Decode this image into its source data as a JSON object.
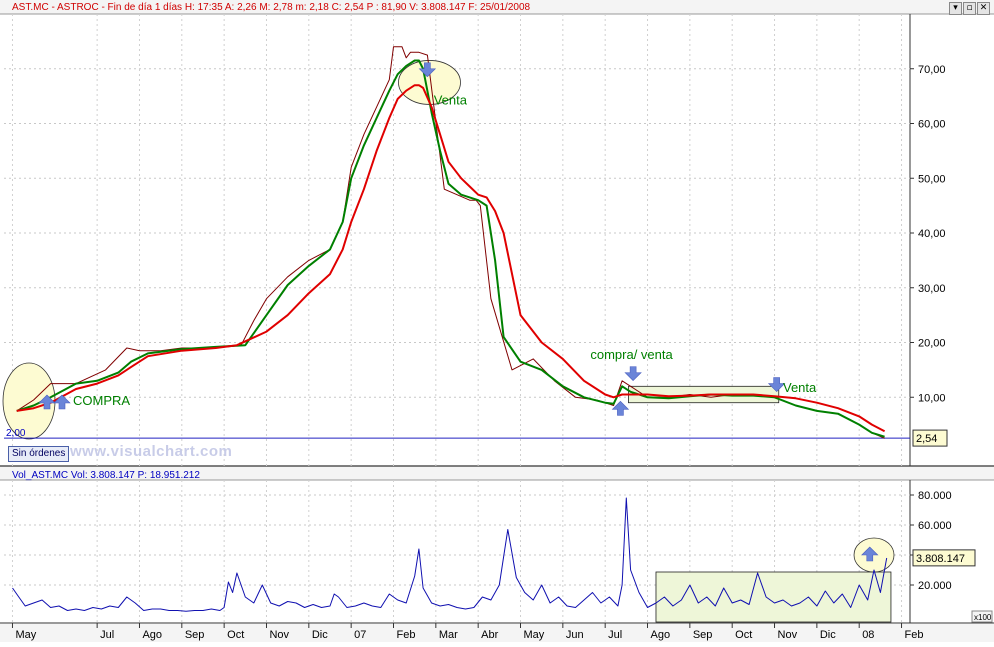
{
  "header": {
    "text": "AST.MC - ASTROC - Fin de día 1 días H: 17:35  A: 2,26  M: 2,78  m: 2,18  C: 2,54  P : 81,90  V: 3.808.147  F: 25/01/2008"
  },
  "window_buttons": [
    "▾",
    "▫",
    "✕"
  ],
  "window_buttons_names": [
    "minimize",
    "restore",
    "close"
  ],
  "sin_ordenes_label": "Sin órdenes",
  "watermark": "www.visualchart.com",
  "volume_header": "Vol_AST.MC  Vol: 3.808.147   P: 18.951.212",
  "volume_scale_note": "x100",
  "annotations": {
    "compra": "COMPRA",
    "venta_top": "Venta",
    "compra_venta": "compra/ venta",
    "venta_right": "Venta",
    "low_value": "2,00"
  },
  "colors": {
    "price": "#800000",
    "ma_fast": "#008000",
    "ma_slow": "#e00000",
    "volume": "#1010b0",
    "arrow": "#6a84d8",
    "highlight_fill": "#eef6d8",
    "axis_blue": "#2020c0"
  },
  "chart_data": [
    {
      "type": "line",
      "title": "AST.MC - ASTROC",
      "y_axis": "right",
      "ylim": [
        0,
        80
      ],
      "y_ticks": [
        "10,00",
        "20,00",
        "30,00",
        "40,00",
        "50,00",
        "60,00",
        "70,00"
      ],
      "y_tick_values": [
        10,
        20,
        30,
        40,
        50,
        60,
        70
      ],
      "last_value_label": "2,54",
      "last_value": 2.54,
      "x_months": [
        "May",
        "Jul",
        "Ago",
        "Sep",
        "Oct",
        "Nov",
        "Dic",
        "07",
        "Feb",
        "Mar",
        "Abr",
        "May",
        "Jun",
        "Jul",
        "Ago",
        "Sep",
        "Oct",
        "Nov",
        "Dic",
        "08",
        "Feb"
      ],
      "x_month_positions": [
        0,
        2,
        3,
        4,
        5,
        6,
        7,
        8,
        9,
        10,
        11,
        12,
        13,
        14,
        15,
        16,
        17,
        18,
        19,
        20,
        21
      ],
      "xlim": [
        -0.2,
        21.2
      ],
      "series": [
        {
          "role": "price",
          "x": [
            0.1,
            0.5,
            0.9,
            1.5,
            2.2,
            2.7,
            3.0,
            3.5,
            4.0,
            4.8,
            5.4,
            5.7,
            6.0,
            6.5,
            7.0,
            7.5,
            7.8,
            8.0,
            8.3,
            8.6,
            8.9,
            9.0,
            9.2,
            9.3,
            9.4,
            9.6,
            9.8,
            10.2,
            10.8,
            10.95,
            11.05,
            11.3,
            11.8,
            12.3,
            12.8,
            13.3,
            13.8,
            14.2,
            14.4,
            14.6,
            15.0,
            15.5,
            16.0,
            16.5,
            17.0,
            17.5,
            18.0,
            18.5,
            19.0,
            19.5,
            20.0,
            20.3,
            20.6
          ],
          "values": [
            7.5,
            9.5,
            12.5,
            12.5,
            15.0,
            19.0,
            18.5,
            18.5,
            19.0,
            19.0,
            19.5,
            24.0,
            28.0,
            32.0,
            35.0,
            37.0,
            42.0,
            52.0,
            58.0,
            63.0,
            68.0,
            74.0,
            74.0,
            72.0,
            73.0,
            73.0,
            72.5,
            48.0,
            46.0,
            46.0,
            45.0,
            28.0,
            15.0,
            17.0,
            13.0,
            10.0,
            9.5,
            8.5,
            13.0,
            12.0,
            10.0,
            10.0,
            10.5,
            10.0,
            10.5,
            10.5,
            10.0,
            8.5,
            7.5,
            7.0,
            5.0,
            3.5,
            2.5
          ]
        },
        {
          "role": "ma_fast",
          "x": [
            0.1,
            0.5,
            0.9,
            1.5,
            2.0,
            2.5,
            2.8,
            3.2,
            4.0,
            4.8,
            5.5,
            6.0,
            6.5,
            7.0,
            7.5,
            7.8,
            8.0,
            8.3,
            8.6,
            8.9,
            9.1,
            9.3,
            9.5,
            9.6,
            9.7,
            9.9,
            10.1,
            10.3,
            10.6,
            10.8,
            11.0,
            11.2,
            11.4,
            11.6,
            12.0,
            12.5,
            13.0,
            13.5,
            14.0,
            14.2,
            14.4,
            14.6,
            15.0,
            15.5,
            16.0,
            16.5,
            17.0,
            17.5,
            18.0,
            18.5,
            19.0,
            19.5,
            20.0,
            20.3,
            20.6
          ],
          "values": [
            7.5,
            8.5,
            10.0,
            12.5,
            13.0,
            14.5,
            16.5,
            18.0,
            18.8,
            19.2,
            19.5,
            25.0,
            30.5,
            34.0,
            37.0,
            42.0,
            50.0,
            56.0,
            61.0,
            66.0,
            69.0,
            70.5,
            71.5,
            71.5,
            70.0,
            62.0,
            55.0,
            49.0,
            47.0,
            46.5,
            46.0,
            45.0,
            35.0,
            21.0,
            16.5,
            15.0,
            12.0,
            10.0,
            9.0,
            8.8,
            12.0,
            11.0,
            10.0,
            9.8,
            10.2,
            10.5,
            10.3,
            10.3,
            10.0,
            8.5,
            7.5,
            7.0,
            5.0,
            3.5,
            2.8
          ]
        },
        {
          "role": "ma_slow",
          "x": [
            0.1,
            0.5,
            0.9,
            1.5,
            2.0,
            2.5,
            2.8,
            3.2,
            4.0,
            4.8,
            5.3,
            6.0,
            6.5,
            7.0,
            7.5,
            7.8,
            8.0,
            8.3,
            8.6,
            8.9,
            9.1,
            9.3,
            9.5,
            9.6,
            9.7,
            9.9,
            10.1,
            10.3,
            10.6,
            10.8,
            11.0,
            11.2,
            11.4,
            11.6,
            12.0,
            12.5,
            13.0,
            13.5,
            14.0,
            14.2,
            14.4,
            14.6,
            15.0,
            15.5,
            16.0,
            16.5,
            17.0,
            17.5,
            18.0,
            18.5,
            19.0,
            19.5,
            20.0,
            20.3,
            20.6
          ],
          "values": [
            7.5,
            8.0,
            9.0,
            11.5,
            12.5,
            14.0,
            15.5,
            17.5,
            18.5,
            19.0,
            19.5,
            22.0,
            25.0,
            29.0,
            32.5,
            37.0,
            42.0,
            48.0,
            55.0,
            61.0,
            64.5,
            66.0,
            67.0,
            67.0,
            66.5,
            63.0,
            58.0,
            53.0,
            50.0,
            48.5,
            47.0,
            46.5,
            44.0,
            40.0,
            25.0,
            20.0,
            17.0,
            13.0,
            10.5,
            10.0,
            10.5,
            10.5,
            10.5,
            10.2,
            10.3,
            10.5,
            10.5,
            10.5,
            10.2,
            9.8,
            9.0,
            8.0,
            6.5,
            5.0,
            3.8
          ]
        }
      ]
    },
    {
      "type": "line",
      "title": "Vol_AST.MC",
      "y_axis": "right",
      "ylim": [
        0,
        90000
      ],
      "y_ticks": [
        "20.000",
        "40.000",
        "60.000",
        "80.000"
      ],
      "y_tick_values": [
        20000,
        40000,
        60000,
        80000
      ],
      "last_value_label": "3.808.147",
      "last_value": 38081,
      "xlim": [
        -0.2,
        21.2
      ],
      "series": [
        {
          "role": "volume",
          "x": [
            0.0,
            0.15,
            0.3,
            0.5,
            0.7,
            0.9,
            1.1,
            1.3,
            1.5,
            1.7,
            1.9,
            2.1,
            2.3,
            2.5,
            2.7,
            2.9,
            3.1,
            3.3,
            3.5,
            3.7,
            3.9,
            4.1,
            4.3,
            4.5,
            4.7,
            4.9,
            5.0,
            5.1,
            5.2,
            5.3,
            5.5,
            5.7,
            5.9,
            6.1,
            6.3,
            6.5,
            6.7,
            6.9,
            7.1,
            7.3,
            7.5,
            7.6,
            7.7,
            7.9,
            8.1,
            8.3,
            8.5,
            8.7,
            8.9,
            9.1,
            9.3,
            9.5,
            9.6,
            9.7,
            9.9,
            10.1,
            10.3,
            10.5,
            10.7,
            10.9,
            11.1,
            11.3,
            11.5,
            11.7,
            11.9,
            12.1,
            12.3,
            12.5,
            12.7,
            12.9,
            13.1,
            13.3,
            13.5,
            13.7,
            13.9,
            14.1,
            14.3,
            14.4,
            14.5,
            14.6,
            14.8,
            15.0,
            15.2,
            15.4,
            15.6,
            15.8,
            16.0,
            16.2,
            16.4,
            16.6,
            16.8,
            17.0,
            17.2,
            17.4,
            17.6,
            17.8,
            18.0,
            18.2,
            18.4,
            18.6,
            18.8,
            19.0,
            19.2,
            19.4,
            19.6,
            19.8,
            20.0,
            20.2,
            20.35,
            20.5,
            20.65
          ],
          "values": [
            18000,
            12000,
            6000,
            8000,
            10000,
            5000,
            6000,
            3000,
            4000,
            3000,
            5000,
            4000,
            6000,
            5000,
            12000,
            8000,
            3000,
            4000,
            4000,
            3000,
            3000,
            2500,
            3000,
            3000,
            4000,
            3000,
            5000,
            22000,
            15000,
            28000,
            12000,
            8000,
            20000,
            8000,
            6000,
            9000,
            8000,
            5000,
            7000,
            5000,
            6000,
            14000,
            12000,
            5000,
            6000,
            8000,
            6000,
            5000,
            14000,
            10000,
            8000,
            26000,
            44000,
            18000,
            8000,
            6000,
            7000,
            5000,
            4000,
            5000,
            12000,
            10000,
            20000,
            57000,
            25000,
            15000,
            10000,
            20000,
            8000,
            12000,
            6000,
            5000,
            10000,
            15000,
            8000,
            12000,
            6000,
            20000,
            78000,
            30000,
            15000,
            5000,
            8000,
            12000,
            6000,
            10000,
            20000,
            8000,
            12000,
            6000,
            18000,
            8000,
            10000,
            7000,
            28000,
            12000,
            8000,
            10000,
            6000,
            8000,
            12000,
            6000,
            16000,
            8000,
            14000,
            5000,
            20000,
            10000,
            30000,
            15000,
            38000
          ]
        }
      ]
    }
  ]
}
